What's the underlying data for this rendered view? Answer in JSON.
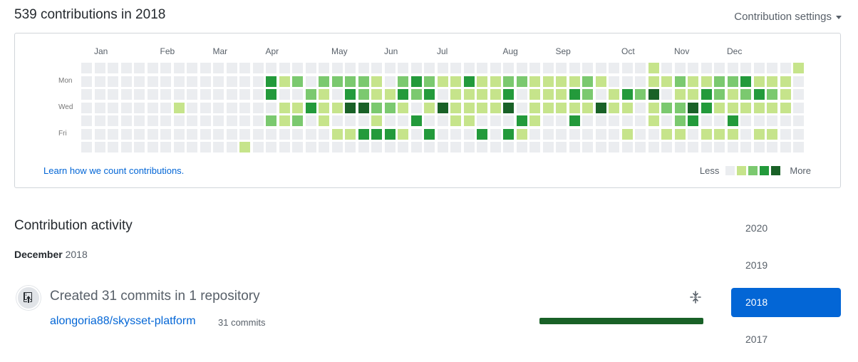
{
  "header": {
    "title": "539 contributions in 2018",
    "settings_label": "Contribution settings"
  },
  "calendar": {
    "months": [
      {
        "label": "Jan",
        "week": 0
      },
      {
        "label": "Feb",
        "week": 5
      },
      {
        "label": "Mar",
        "week": 9
      },
      {
        "label": "Apr",
        "week": 13
      },
      {
        "label": "May",
        "week": 18
      },
      {
        "label": "Jun",
        "week": 22
      },
      {
        "label": "Jul",
        "week": 26
      },
      {
        "label": "Aug",
        "week": 31
      },
      {
        "label": "Sep",
        "week": 35
      },
      {
        "label": "Oct",
        "week": 40
      },
      {
        "label": "Nov",
        "week": 44
      },
      {
        "label": "Dec",
        "week": 48
      }
    ],
    "day_labels": [
      {
        "label": "Mon",
        "row": 1
      },
      {
        "label": "Wed",
        "row": 3
      },
      {
        "label": "Fri",
        "row": 5
      }
    ],
    "level_colors": [
      "#ebedf0",
      "#c6e48b",
      "#7bc96f",
      "#239a3b",
      "#196127"
    ],
    "weeks": [
      "0000000",
      "0000000",
      "0000000",
      "0000000",
      "0000000",
      "0000000",
      "0000000",
      "0001000",
      "0000000",
      "0000000",
      "0000000",
      "0000000",
      "0000001",
      "0000000",
      "0330200",
      "0101100",
      "0201200",
      "0023000",
      "0211100",
      "0201010",
      "0234010",
      "0224030",
      "0112130",
      "0012030",
      "0231010",
      "0320300",
      "0231030",
      "0104000",
      "0111100",
      "0311100",
      "0111030",
      "0111000",
      "0234030",
      "0200310",
      "0111100",
      "0111000",
      "0111000",
      "0131300",
      "0221000",
      "0104000",
      "0011000",
      "0031010",
      "0020000",
      "1141100",
      "0102010",
      "0212210",
      "0114300",
      "0133010",
      "0221010",
      "0211310",
      "0321000",
      "0131010",
      "0121010",
      "0111000",
      "1000000"
    ],
    "learn_link": "Learn how we count contributions.",
    "legend_less": "Less",
    "legend_more": "More"
  },
  "activity": {
    "title": "Contribution activity",
    "month": "December",
    "year": "2018",
    "summary": "Created 31 commits in 1 repository",
    "repo_name": "alongoria88/skysset-platform",
    "repo_commits": "31 commits",
    "repo_share": 1.0,
    "icons": {
      "repo": "repo-push-icon",
      "collapse": "fold-icon"
    }
  },
  "years": [
    "2020",
    "2019",
    "2018",
    "2017"
  ],
  "selected_year": "2018"
}
